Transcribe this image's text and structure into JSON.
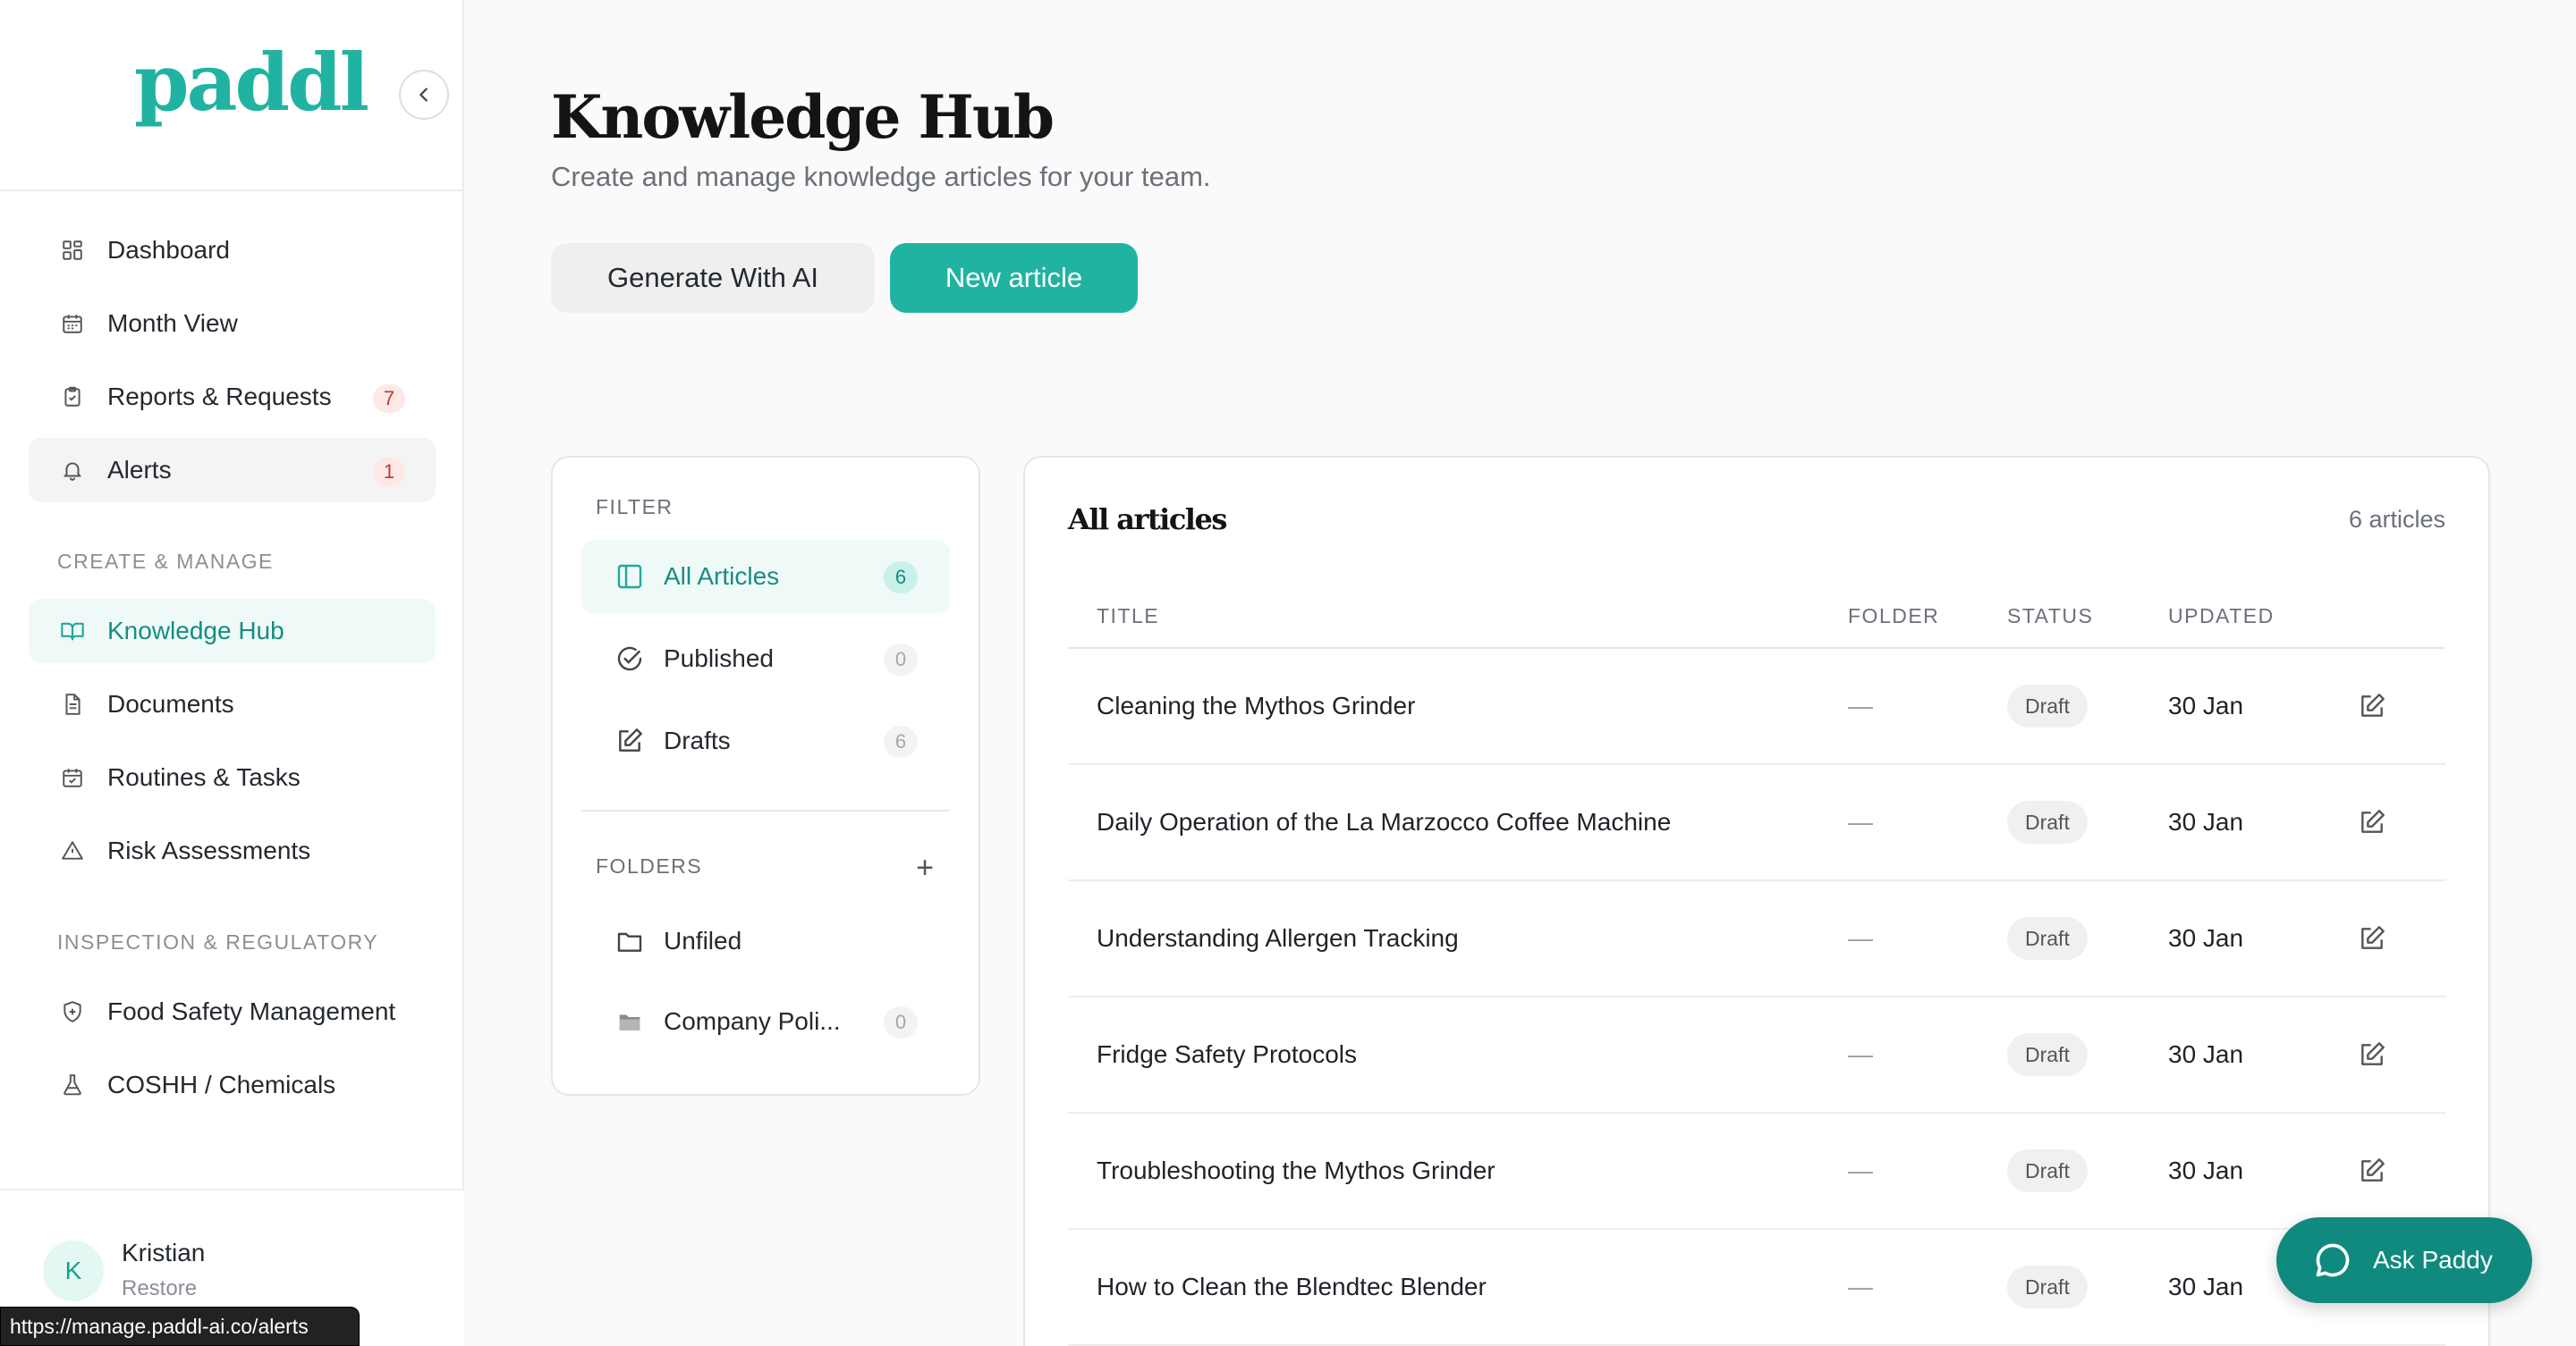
{
  "brand": {
    "logo": "paddl"
  },
  "sidebar": {
    "main_items": [
      {
        "label": "Dashboard",
        "icon": "grid-icon"
      },
      {
        "label": "Month View",
        "icon": "calendar-icon"
      },
      {
        "label": "Reports & Requests",
        "icon": "clipboard-icon",
        "badge": "7"
      },
      {
        "label": "Alerts",
        "icon": "bell-icon",
        "badge": "1"
      }
    ],
    "section_create": "CREATE & MANAGE",
    "create_items": [
      {
        "label": "Knowledge Hub",
        "icon": "book-open-icon"
      },
      {
        "label": "Documents",
        "icon": "document-icon"
      },
      {
        "label": "Routines & Tasks",
        "icon": "calendar-check-icon"
      },
      {
        "label": "Risk Assessments",
        "icon": "warning-triangle-icon"
      }
    ],
    "section_inspection": "INSPECTION & REGULATORY",
    "inspection_items": [
      {
        "label": "Food Safety Management",
        "icon": "shield-icon"
      },
      {
        "label": "COSHH / Chemicals",
        "icon": "flask-icon"
      }
    ],
    "user": {
      "initial": "K",
      "name": "Kristian",
      "sub": "Restore"
    }
  },
  "status_url": "https://manage.paddl-ai.co/alerts",
  "header": {
    "title": "Knowledge Hub",
    "subtitle": "Create and manage knowledge articles for your team.",
    "generate_label": "Generate With AI",
    "new_label": "New article"
  },
  "filter": {
    "label": "FILTER",
    "items": [
      {
        "label": "All Articles",
        "count": "6"
      },
      {
        "label": "Published",
        "count": "0"
      },
      {
        "label": "Drafts",
        "count": "6"
      }
    ],
    "folders_label": "FOLDERS",
    "add_symbol": "+",
    "folders": [
      {
        "label": "Unfiled"
      },
      {
        "label": "Company Poli...",
        "count": "0"
      }
    ]
  },
  "articles": {
    "title": "All articles",
    "count_text": "6 articles",
    "columns": [
      "TITLE",
      "FOLDER",
      "STATUS",
      "UPDATED"
    ],
    "rows": [
      {
        "title": "Cleaning the Mythos Grinder",
        "folder": "—",
        "status": "Draft",
        "updated": "30 Jan"
      },
      {
        "title": "Daily Operation of the La Marzocco Coffee Machine",
        "folder": "—",
        "status": "Draft",
        "updated": "30 Jan"
      },
      {
        "title": "Understanding Allergen Tracking",
        "folder": "—",
        "status": "Draft",
        "updated": "30 Jan"
      },
      {
        "title": "Fridge Safety Protocols",
        "folder": "—",
        "status": "Draft",
        "updated": "30 Jan"
      },
      {
        "title": "Troubleshooting the Mythos Grinder",
        "folder": "—",
        "status": "Draft",
        "updated": "30 Jan"
      },
      {
        "title": "How to Clean the Blendtec Blender",
        "folder": "—",
        "status": "Draft",
        "updated": "30 Jan"
      }
    ]
  },
  "assistant": {
    "label": "Ask Paddy"
  },
  "colors": {
    "accent": "#21b3a2",
    "accent_dark": "#108a7f",
    "badge_red": "#c0392b"
  }
}
